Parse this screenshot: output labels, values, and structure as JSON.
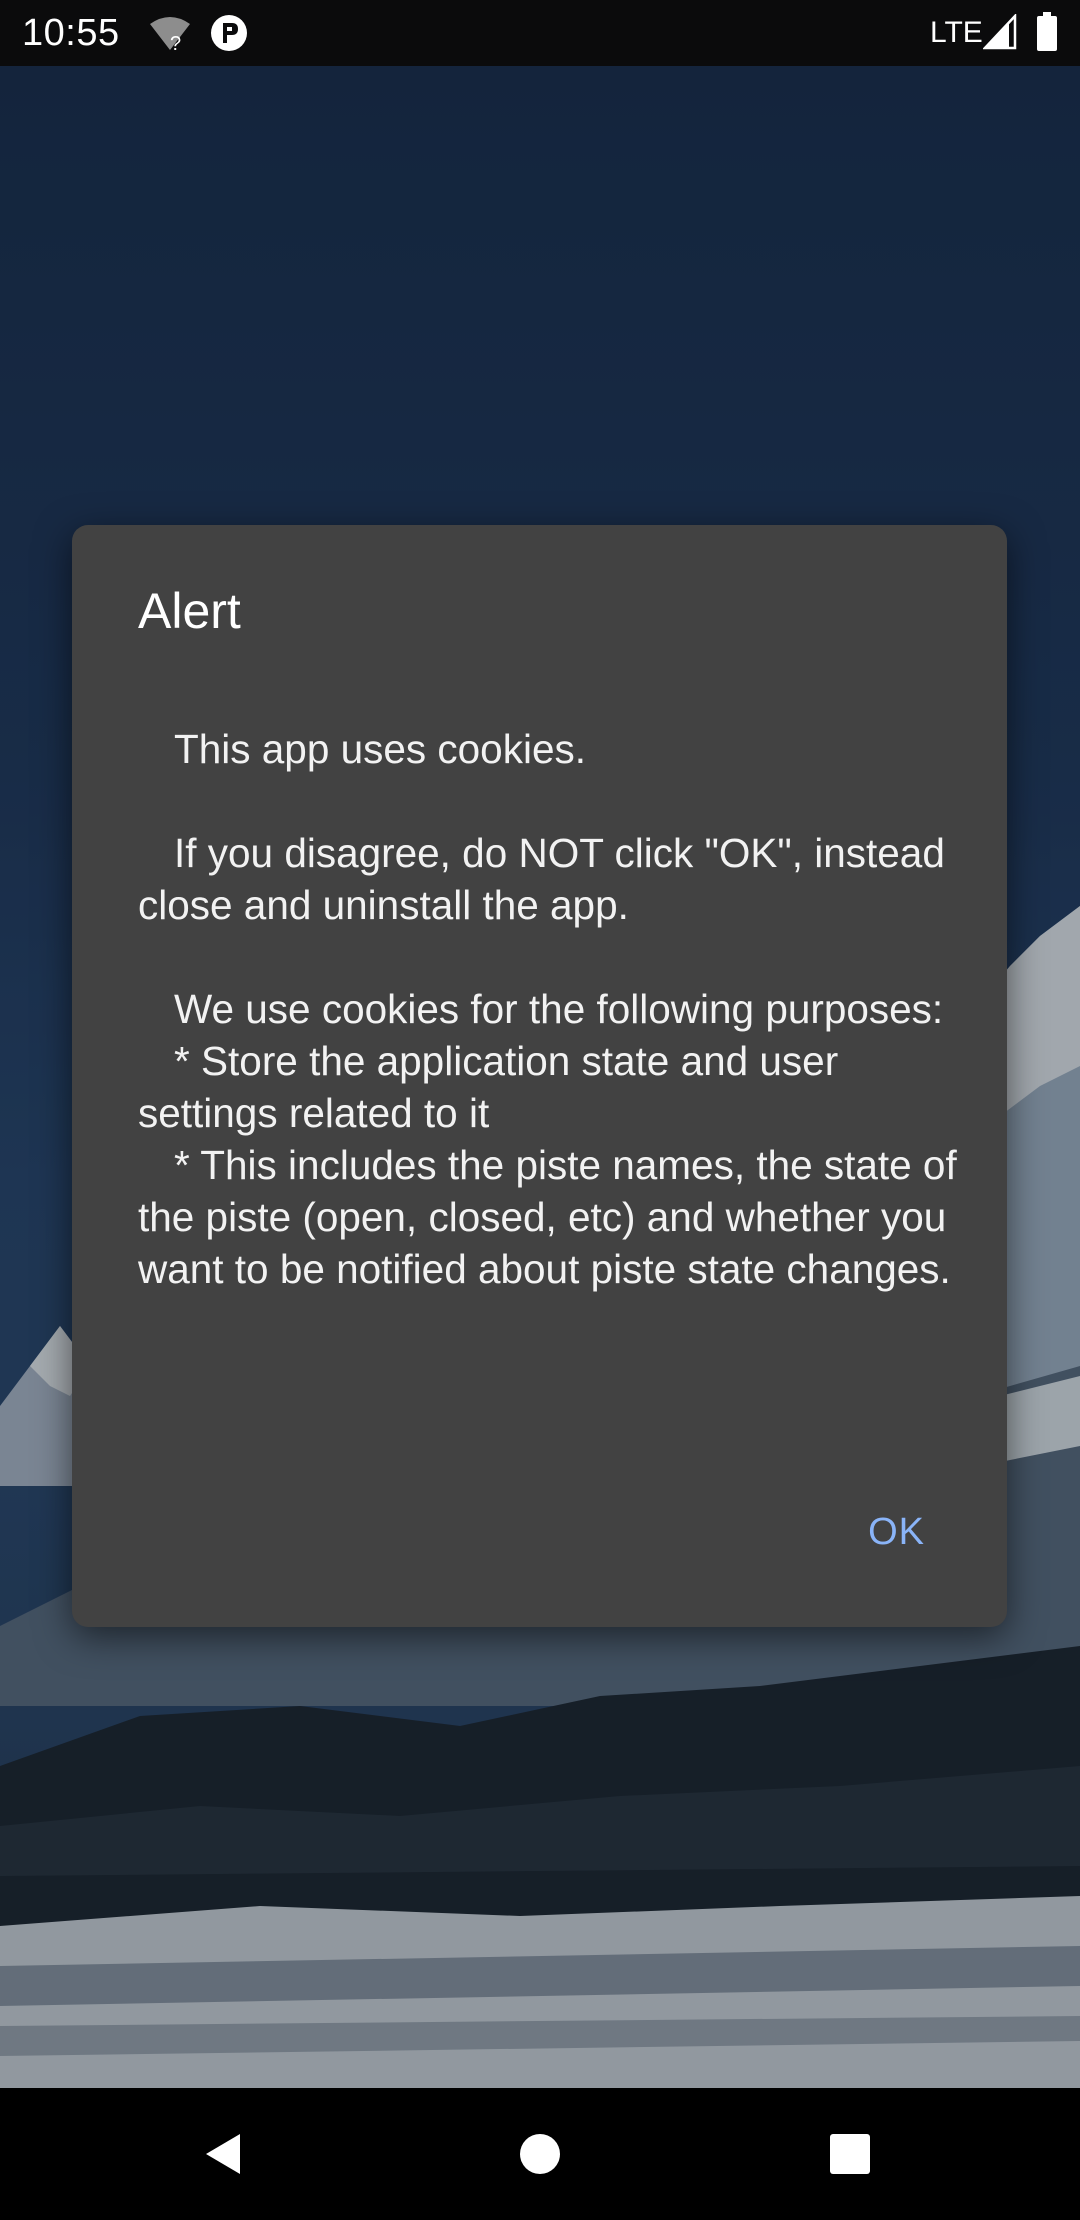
{
  "status_bar": {
    "time": "10:55",
    "network": "LTE",
    "icons": [
      "wifi-unknown-icon",
      "app-notification-icon",
      "signal-icon",
      "battery-icon"
    ]
  },
  "dialog": {
    "title": "Alert",
    "message": "\tThis app uses cookies.\n\n\tIf you disagree, do NOT click \"OK\", instead close and uninstall the app.\n\n\tWe use cookies for the following purposes:\n\t* Store the application state and user settings related to it\n\t* This includes the piste names, the state of the piste (open, closed, etc) and whether you want to be notified about piste state changes.",
    "ok_label": "OK"
  },
  "nav_bar": {
    "icons": [
      "back-icon",
      "home-icon",
      "recents-icon"
    ]
  },
  "colors": {
    "dialog_background": "#424242",
    "accent": "#8ab4f8",
    "scrim": "rgba(0,0,0,0.28)"
  }
}
